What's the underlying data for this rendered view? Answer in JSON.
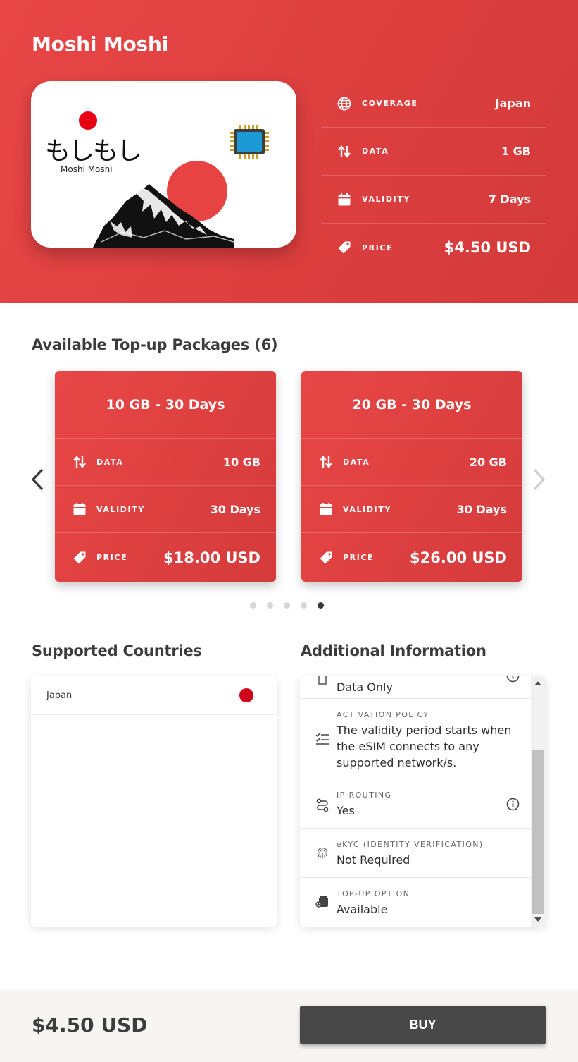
{
  "header": {
    "title": "Moshi Moshi",
    "card": {
      "brand_jp": "もしもし",
      "brand_en": "Moshi Moshi",
      "chip_label": "eSIM"
    },
    "specs": [
      {
        "icon": "globe-icon",
        "label": "COVERAGE",
        "value": "Japan"
      },
      {
        "icon": "swap-vertical-icon",
        "label": "DATA",
        "value": "1 GB"
      },
      {
        "icon": "calendar-icon",
        "label": "VALIDITY",
        "value": "7 Days"
      },
      {
        "icon": "price-tag-icon",
        "label": "PRICE",
        "value": "$4.50 USD"
      }
    ]
  },
  "packages": {
    "title": "Available Top-up Packages (6)",
    "items": [
      {
        "name": "10 GB - 30 Days",
        "data_label": "DATA",
        "data": "10 GB",
        "validity_label": "VALIDITY",
        "validity": "30 Days",
        "price_label": "PRICE",
        "price": "$18.00 USD"
      },
      {
        "name": "20 GB - 30 Days",
        "data_label": "DATA",
        "data": "20 GB",
        "validity_label": "VALIDITY",
        "validity": "30 Days",
        "price_label": "PRICE",
        "price": "$26.00 USD"
      }
    ],
    "dots": 5,
    "active_dot": 5
  },
  "countries": {
    "title": "Supported Countries",
    "items": [
      {
        "name": "Japan",
        "flag_color": "#d0021b"
      }
    ]
  },
  "info": {
    "title": "Additional Information",
    "items": [
      {
        "icon": "sim-icon",
        "label": "",
        "value": "Data Only",
        "has_tip": true
      },
      {
        "icon": "checklist-icon",
        "label": "ACTIVATION POLICY",
        "value": "The validity period starts when the eSIM connects to any supported network/s.",
        "has_tip": false
      },
      {
        "icon": "route-icon",
        "label": "IP ROUTING",
        "value": "Yes",
        "has_tip": true
      },
      {
        "icon": "fingerprint-icon",
        "label": "eKYC (IDENTITY VERIFICATION)",
        "value": "Not Required",
        "has_tip": false
      },
      {
        "icon": "topup-icon",
        "label": "TOP-UP OPTION",
        "value": "Available",
        "has_tip": false
      }
    ]
  },
  "footer": {
    "price": "$4.50 USD",
    "buy_label": "BUY"
  },
  "colors": {
    "brand_red": "#e04343",
    "button_dark": "#484848"
  }
}
